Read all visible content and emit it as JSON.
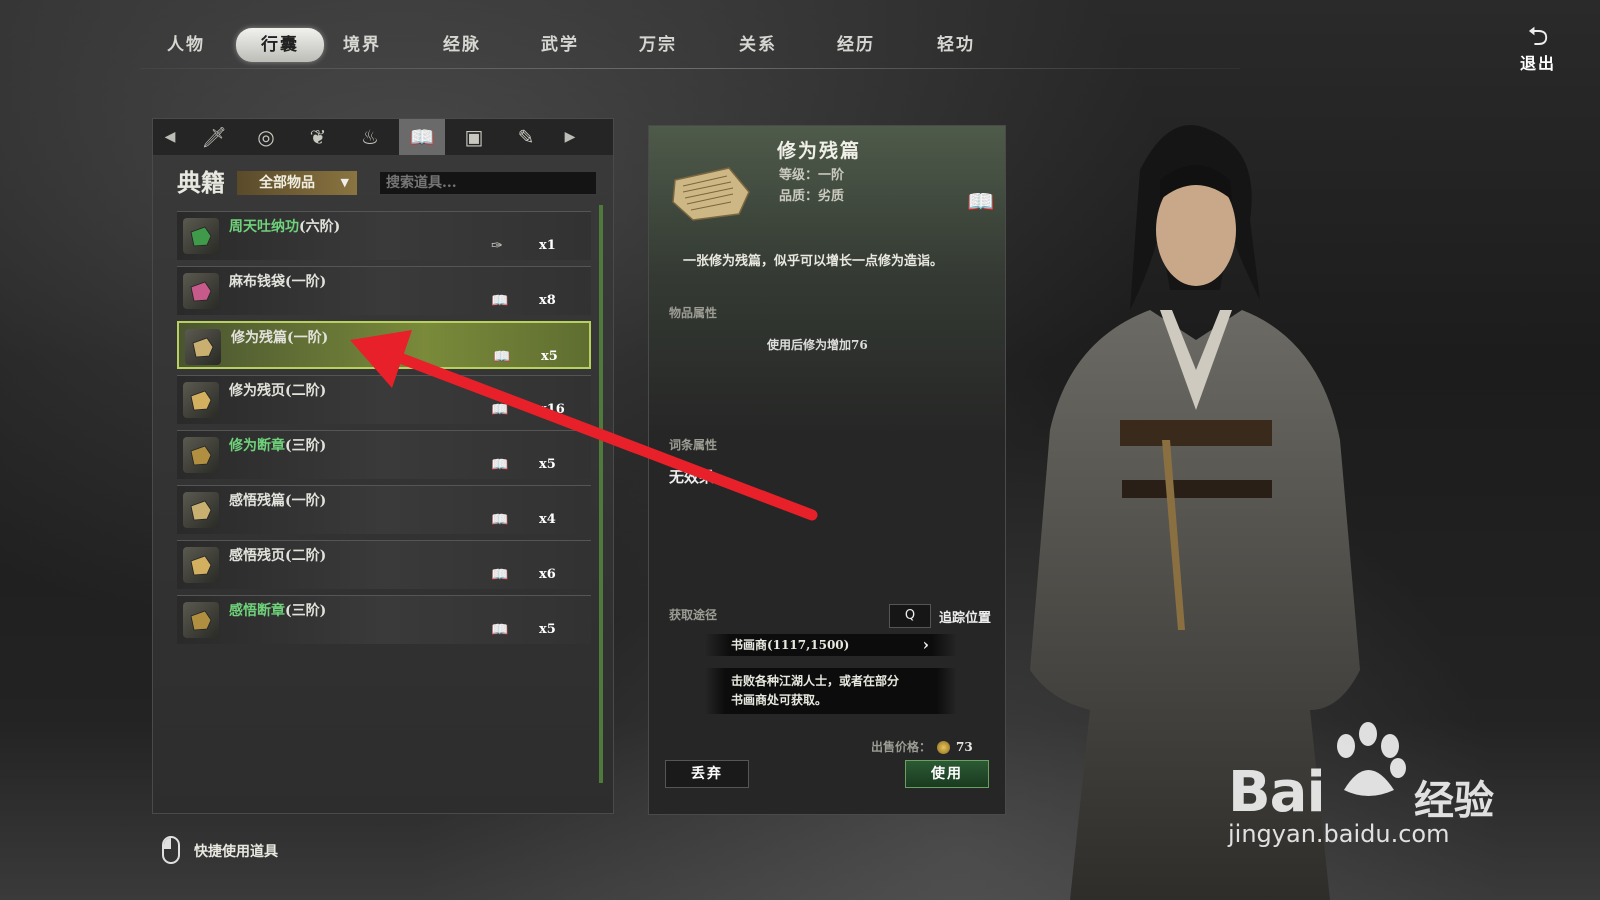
{
  "nav": {
    "tabs": [
      "人物",
      "行囊",
      "境界",
      "经脉",
      "武学",
      "万宗",
      "关系",
      "经历",
      "轻功"
    ],
    "active_index": 1,
    "exit_label": "退出"
  },
  "inventory": {
    "category_title": "典籍",
    "filter_label": "全部物品",
    "search_placeholder": "搜索道具...",
    "categories": [
      "dagger-icon",
      "ring-icon",
      "herb-icon",
      "pouch-icon",
      "book-icon",
      "chest-icon",
      "tool-icon"
    ],
    "active_category": 4,
    "items": [
      {
        "name": "周天吐纳功",
        "tier": "(六阶)",
        "name_color": "green",
        "use_icon": "scroll-icon",
        "qty": "x1",
        "icon_color": "#3f9a4a"
      },
      {
        "name": "麻布钱袋(一阶)",
        "tier": "",
        "name_color": "white",
        "use_icon": "book-icon",
        "qty": "x8",
        "icon_color": "#c65a8a"
      },
      {
        "name": "修为残篇(一阶)",
        "tier": "",
        "name_color": "white",
        "use_icon": "book-icon",
        "qty": "x5",
        "icon_color": "#c9b070",
        "selected": true
      },
      {
        "name": "修为残页(二阶)",
        "tier": "",
        "name_color": "white",
        "use_icon": "book-icon",
        "qty": "x16",
        "icon_color": "#d2b060"
      },
      {
        "name": "修为断章",
        "tier": "(三阶)",
        "name_color": "green",
        "use_icon": "book-icon",
        "qty": "x5",
        "icon_color": "#b09040"
      },
      {
        "name": "感悟残篇(一阶)",
        "tier": "",
        "name_color": "white",
        "use_icon": "book-icon",
        "qty": "x4",
        "icon_color": "#c9b070"
      },
      {
        "name": "感悟残页(二阶)",
        "tier": "",
        "name_color": "white",
        "use_icon": "book-icon",
        "qty": "x6",
        "icon_color": "#d2b060"
      },
      {
        "name": "感悟断章",
        "tier": "(三阶)",
        "name_color": "green",
        "use_icon": "book-icon",
        "qty": "x5",
        "icon_color": "#b09040"
      }
    ]
  },
  "detail": {
    "name": "修为残篇",
    "level": "等级：一阶",
    "quality": "品质：劣质",
    "description": "一张修为残篇，似乎可以增长一点修为造诣。",
    "attr_title": "物品属性",
    "attr_effect": "使用后修为增加76",
    "affix_title": "词条属性",
    "affix_value": "无效果",
    "source_title": "获取途径",
    "track_key": "Q",
    "track_label": "追踪位置",
    "source_location": "书画商(1117,1500)",
    "source_desc_1": "击败各种江湖人士，或者在部分",
    "source_desc_2": "书画商处可获取。",
    "price_label": "出售价格：",
    "price_value": "73",
    "drop_label": "丢弃",
    "use_label": "使用"
  },
  "footer": {
    "hint": "快捷使用道具"
  },
  "watermark": {
    "brand_latin": "Bai",
    "brand_cn": "经验",
    "url": "jingyan.baidu.com"
  },
  "colors": {
    "accent_green": "#6fd27a",
    "selection_border": "#b8d060",
    "annotation_arrow": "#e8202a"
  }
}
